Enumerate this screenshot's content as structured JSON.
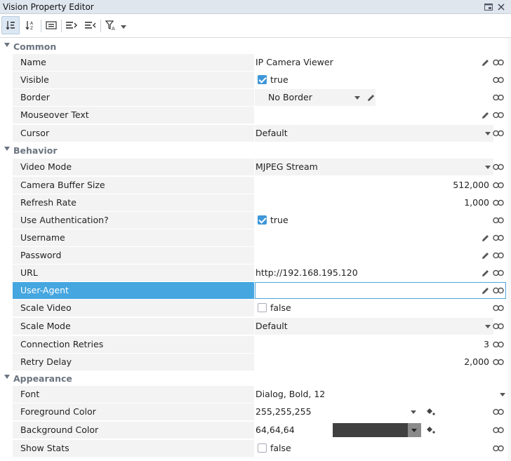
{
  "window": {
    "title": "Vision Property Editor"
  },
  "toolbar": {
    "buttons": [
      "sort-categorized",
      "sort-alphabetical",
      "show-descriptions",
      "expand-all",
      "collapse-all",
      "filter"
    ]
  },
  "sections": {
    "common": "Common",
    "behavior": "Behavior",
    "appearance": "Appearance"
  },
  "props": {
    "name": {
      "label": "Name",
      "value": "IP Camera Viewer"
    },
    "visible": {
      "label": "Visible",
      "value": "true"
    },
    "border": {
      "label": "Border",
      "value": "No Border"
    },
    "mouseover": {
      "label": "Mouseover Text",
      "value": ""
    },
    "cursor": {
      "label": "Cursor",
      "value": "Default"
    },
    "video_mode": {
      "label": "Video Mode",
      "value": "MJPEG Stream"
    },
    "camera_buffer": {
      "label": "Camera Buffer Size",
      "value": "512,000"
    },
    "refresh_rate": {
      "label": "Refresh Rate",
      "value": "1,000"
    },
    "use_auth": {
      "label": "Use Authentication?",
      "value": "true"
    },
    "username": {
      "label": "Username",
      "value": ""
    },
    "password": {
      "label": "Password",
      "value": ""
    },
    "url": {
      "label": "URL",
      "value": "http://192.168.195.120"
    },
    "user_agent": {
      "label": "User-Agent",
      "value": ""
    },
    "scale_video": {
      "label": "Scale Video",
      "value": "false"
    },
    "scale_mode": {
      "label": "Scale Mode",
      "value": "Default"
    },
    "conn_retries": {
      "label": "Connection Retries",
      "value": "3"
    },
    "retry_delay": {
      "label": "Retry Delay",
      "value": "2,000"
    },
    "font": {
      "label": "Font",
      "value": "Dialog, Bold, 12"
    },
    "fg_color": {
      "label": "Foreground Color",
      "value": "255,255,255"
    },
    "bg_color": {
      "label": "Background Color",
      "value": "64,64,64"
    },
    "show_stats": {
      "label": "Show Stats",
      "value": "false"
    }
  },
  "colors": {
    "selection": "#45a6e0",
    "background_swatch": "#404040",
    "foreground_swatch": "#ffffff",
    "checkbox_checked": "#3f97d8"
  }
}
